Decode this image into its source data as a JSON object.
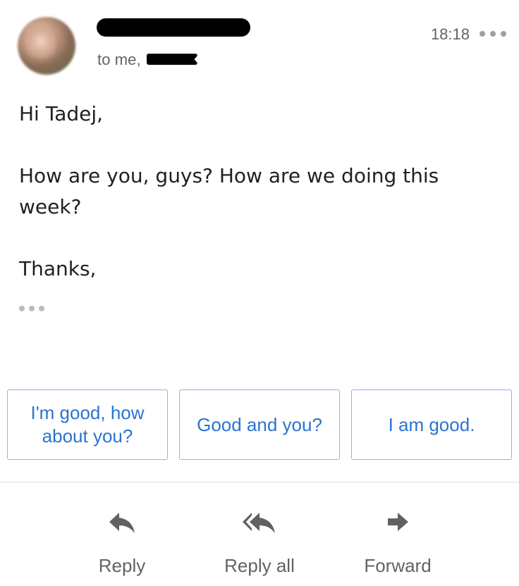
{
  "header": {
    "to_prefix": "to me,",
    "time": "18:18",
    "more_icon": "more-horizontal-icon",
    "avatar_icon": "avatar"
  },
  "message": {
    "greeting": "Hi Tadej,",
    "line1": "How are you, guys? How are we doing this week?",
    "signoff": "Thanks,",
    "quoted_icon": "show-trimmed-content-icon"
  },
  "smart_replies": [
    {
      "label": "I'm good, how about you?"
    },
    {
      "label": "Good and you?"
    },
    {
      "label": "I am good."
    }
  ],
  "actions": {
    "reply": {
      "label": "Reply",
      "icon": "reply-icon"
    },
    "reply_all": {
      "label": "Reply all",
      "icon": "reply-all-icon"
    },
    "forward": {
      "label": "Forward",
      "icon": "forward-icon"
    }
  },
  "colors": {
    "accent": "#2a74d1",
    "chip_border": "#8ab4e8",
    "secondary_text": "#5f6368",
    "icon": "#616161"
  }
}
